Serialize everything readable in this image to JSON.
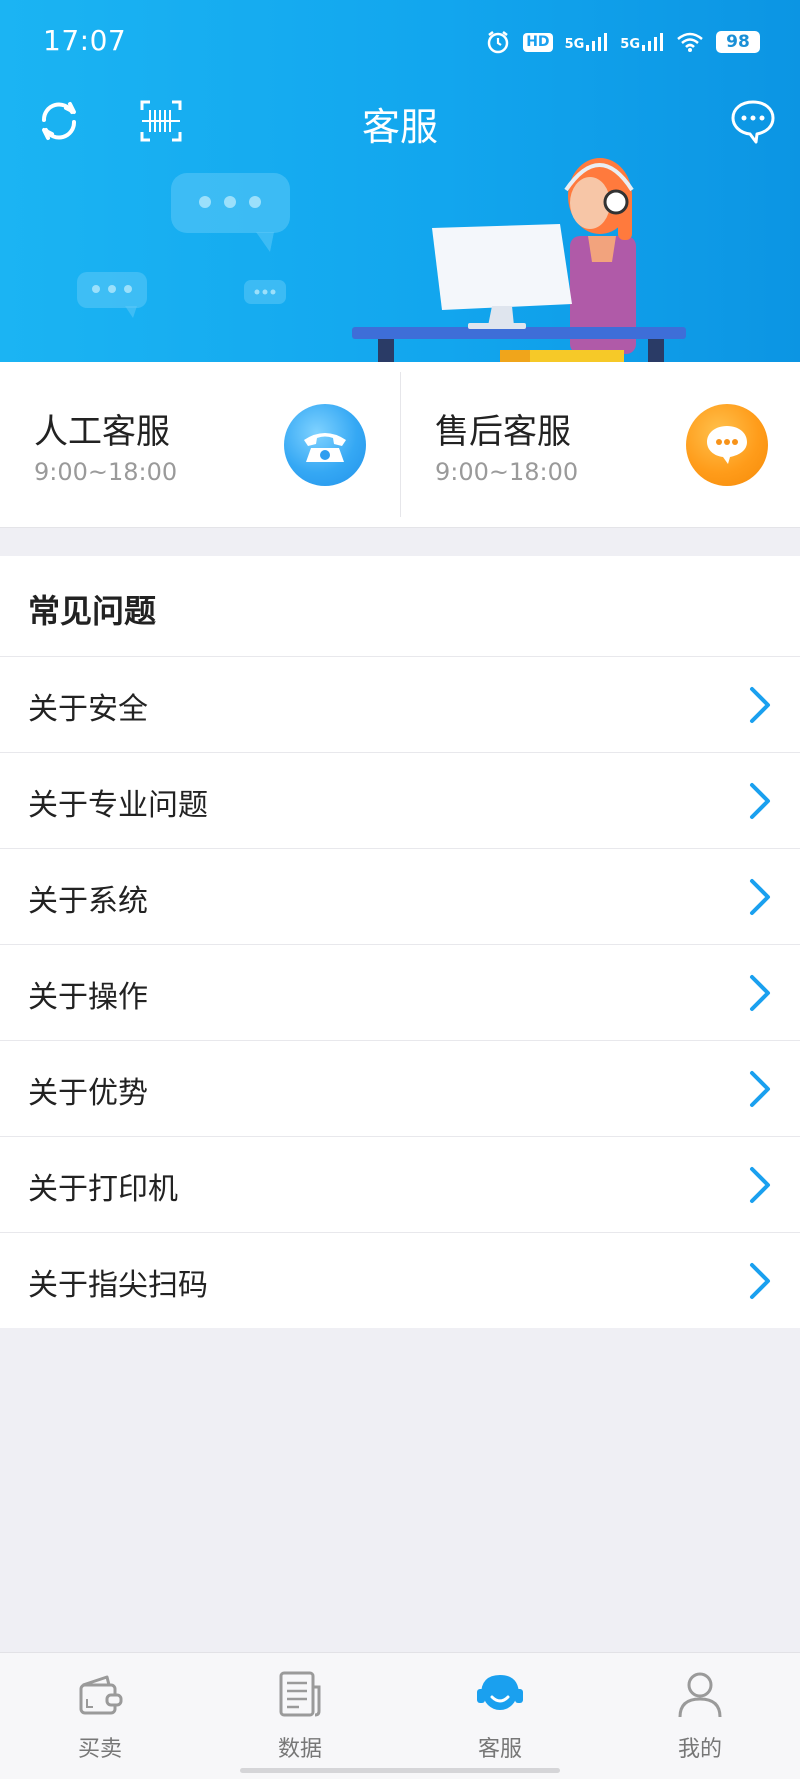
{
  "status_bar": {
    "time": "17:07",
    "hd": "HD",
    "net1": "5G",
    "net2": "5G",
    "battery": "98"
  },
  "header": {
    "title": "客服"
  },
  "service_cards": [
    {
      "name": "人工客服",
      "hours": "9:00~18:00"
    },
    {
      "name": "售后客服",
      "hours": "9:00~18:00"
    }
  ],
  "faq": {
    "title": "常见问题",
    "items": [
      {
        "label": "关于安全"
      },
      {
        "label": "关于专业问题"
      },
      {
        "label": "关于系统"
      },
      {
        "label": "关于操作"
      },
      {
        "label": "关于优势"
      },
      {
        "label": "关于打印机"
      },
      {
        "label": "关于指尖扫码"
      }
    ]
  },
  "tabs": [
    {
      "label": "买卖",
      "icon": "wallet-icon"
    },
    {
      "label": "数据",
      "icon": "document-icon"
    },
    {
      "label": "客服",
      "icon": "headset-icon",
      "active": true
    },
    {
      "label": "我的",
      "icon": "person-icon"
    }
  ],
  "colors": {
    "brand_blue": "#12a6ee",
    "chevron_blue": "#1aa0ef",
    "tab_active": "#1aa0ef"
  }
}
